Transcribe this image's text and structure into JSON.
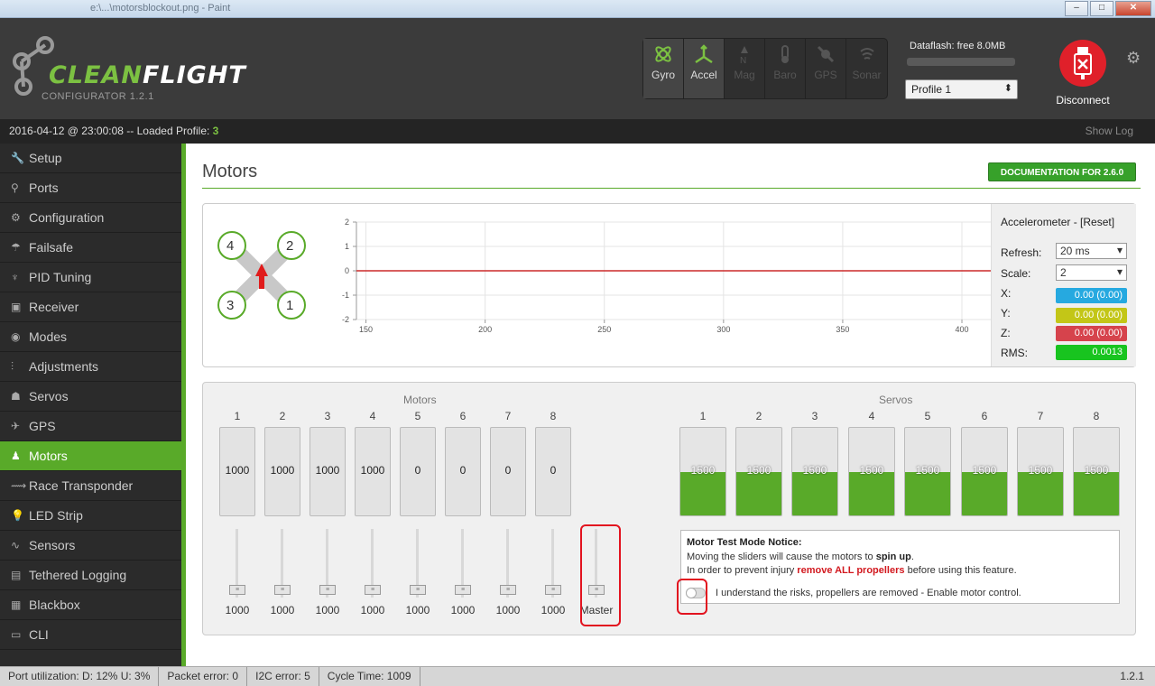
{
  "window": {
    "title": "e:\\...\\motorsblockout.png - Paint",
    "min": "–",
    "max": "□",
    "close": "✕"
  },
  "app": {
    "brand_a": "CLEAN",
    "brand_b": "FLIGHT",
    "subtitle": "CONFIGURATOR  1.2.1"
  },
  "sensors": [
    {
      "name": "Gyro",
      "active": true
    },
    {
      "name": "Accel",
      "active": true
    },
    {
      "name": "Mag",
      "active": false
    },
    {
      "name": "Baro",
      "active": false
    },
    {
      "name": "GPS",
      "active": false
    },
    {
      "name": "Sonar",
      "active": false
    }
  ],
  "dataflash": {
    "label": "Dataflash: free 8.0MB"
  },
  "profile": {
    "selected": "Profile 1"
  },
  "disconnect": {
    "label": "Disconnect"
  },
  "status": {
    "prefix": "2016-04-12 @ 23:00:08 -- Loaded Profile: ",
    "profile": "3",
    "show_log": "Show Log"
  },
  "nav": [
    {
      "label": "Setup",
      "icon": "wrench-icon",
      "glyph": "🔧"
    },
    {
      "label": "Ports",
      "icon": "plug-icon",
      "glyph": "⚲"
    },
    {
      "label": "Configuration",
      "icon": "gear-icon",
      "glyph": "⚙"
    },
    {
      "label": "Failsafe",
      "icon": "parachute-icon",
      "glyph": "☂"
    },
    {
      "label": "PID Tuning",
      "icon": "sitemap-icon",
      "glyph": "♆"
    },
    {
      "label": "Receiver",
      "icon": "receiver-icon",
      "glyph": "▣"
    },
    {
      "label": "Modes",
      "icon": "toggle-icon",
      "glyph": "◉"
    },
    {
      "label": "Adjustments",
      "icon": "sliders-icon",
      "glyph": "⫶"
    },
    {
      "label": "Servos",
      "icon": "servo-icon",
      "glyph": "☗"
    },
    {
      "label": "GPS",
      "icon": "satellite-icon",
      "glyph": "✈"
    },
    {
      "label": "Motors",
      "icon": "motor-icon",
      "glyph": "♟"
    },
    {
      "label": "Race Transponder",
      "icon": "transponder-icon",
      "glyph": "⟿"
    },
    {
      "label": "LED Strip",
      "icon": "led-icon",
      "glyph": "💡"
    },
    {
      "label": "Sensors",
      "icon": "pulse-icon",
      "glyph": "∿"
    },
    {
      "label": "Tethered Logging",
      "icon": "keyboard-icon",
      "glyph": "▤"
    },
    {
      "label": "Blackbox",
      "icon": "blackbox-icon",
      "glyph": "▦"
    },
    {
      "label": "CLI",
      "icon": "terminal-icon",
      "glyph": "▭"
    }
  ],
  "page": {
    "title": "Motors",
    "doc_button": "DOCUMENTATION FOR 2.6.0"
  },
  "quad": {
    "motors": [
      "4",
      "2",
      "3",
      "1"
    ]
  },
  "chart_data": {
    "type": "line",
    "x_ticks": [
      "150",
      "200",
      "250",
      "300",
      "350",
      "400"
    ],
    "y_ticks": [
      "2",
      "1",
      "0",
      "-1",
      "-2"
    ],
    "ylim": [
      -2,
      2
    ],
    "xlim": [
      146,
      414
    ],
    "grid": true,
    "series": [
      {
        "color": "#cc2a2a",
        "x": [
          146,
          414
        ],
        "values": [
          0,
          0
        ]
      }
    ]
  },
  "accel": {
    "title": "Accelerometer - [Reset]",
    "refresh_label": "Refresh:",
    "refresh_value": "20 ms",
    "scale_label": "Scale:",
    "scale_value": "2",
    "x_label": "X:",
    "x_value": "0.00 (0.00)",
    "y_label": "Y:",
    "y_value": "0.00 (0.00)",
    "z_label": "Z:",
    "z_value": "0.00 (0.00)",
    "rms_label": "RMS:",
    "rms_value": "0.0013",
    "colors": {
      "x": "#26a9e0",
      "y": "#c3c617",
      "z": "#d6434c",
      "rms": "#18c41f"
    }
  },
  "motors_section": {
    "label": "Motors",
    "numbers": [
      "1",
      "2",
      "3",
      "4",
      "5",
      "6",
      "7",
      "8"
    ],
    "box_values": [
      "1000",
      "1000",
      "1000",
      "1000",
      "0",
      "0",
      "0",
      "0"
    ],
    "slider_values": [
      "1000",
      "1000",
      "1000",
      "1000",
      "1000",
      "1000",
      "1000",
      "1000"
    ],
    "master_label": "Master"
  },
  "servos_section": {
    "label": "Servos",
    "numbers": [
      "1",
      "2",
      "3",
      "4",
      "5",
      "6",
      "7",
      "8"
    ],
    "values": [
      "1500",
      "1500",
      "1500",
      "1500",
      "1500",
      "1500",
      "1500",
      "1500"
    ]
  },
  "notice": {
    "title": "Motor Test Mode Notice:",
    "line1a": "Moving the sliders will cause the motors to ",
    "line1b": "spin up",
    ".": ".",
    "line2a": "In order to prevent injury ",
    "line2b": "remove ALL propellers",
    "line2c": " before using this feature.",
    "toggle_label": "I understand the risks, propellers are removed - Enable motor control."
  },
  "footer": {
    "port": "Port utilization: D: 12% U: 3%",
    "packet": "Packet error: 0",
    "i2c": "I2C error: 5",
    "cycle": "Cycle Time: 1009",
    "version": "1.2.1"
  }
}
